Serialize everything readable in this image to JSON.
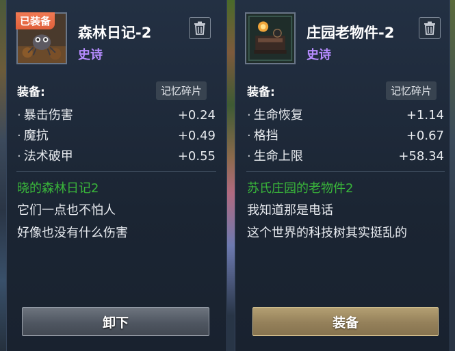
{
  "cards": [
    {
      "badge": "已装备",
      "name": "森林日记-2",
      "rarity": "史诗",
      "rarity_color": "#b68cff",
      "section_label": "装备:",
      "tag": "记忆碎片",
      "stats": [
        {
          "name": "暴击伤害",
          "value": "+0.24"
        },
        {
          "name": "魔抗",
          "value": "+0.49"
        },
        {
          "name": "法术破甲",
          "value": "+0.55"
        }
      ],
      "lore_title": "晓的森林日记2",
      "lore_lines": [
        "它们一点也不怕人",
        "好像也没有什么伤害"
      ],
      "action_button": "卸下",
      "trash_icon": "trash-icon"
    },
    {
      "badge": "",
      "name": "庄园老物件-2",
      "rarity": "史诗",
      "rarity_color": "#b68cff",
      "section_label": "装备:",
      "tag": "记忆碎片",
      "stats": [
        {
          "name": "生命恢复",
          "value": "+1.14"
        },
        {
          "name": "格挡",
          "value": "+0.67"
        },
        {
          "name": "生命上限",
          "value": "+58.34"
        }
      ],
      "lore_title": "苏氏庄园的老物件2",
      "lore_lines": [
        "我知道那是电话",
        "这个世界的科技树其实挺乱的"
      ],
      "action_button": "装备",
      "trash_icon": "trash-icon"
    }
  ],
  "colors": {
    "lore_title": "#39b53a",
    "badge": "#e8643e",
    "equip_button": "#a08c64",
    "unequip_button": "#5a616b"
  }
}
